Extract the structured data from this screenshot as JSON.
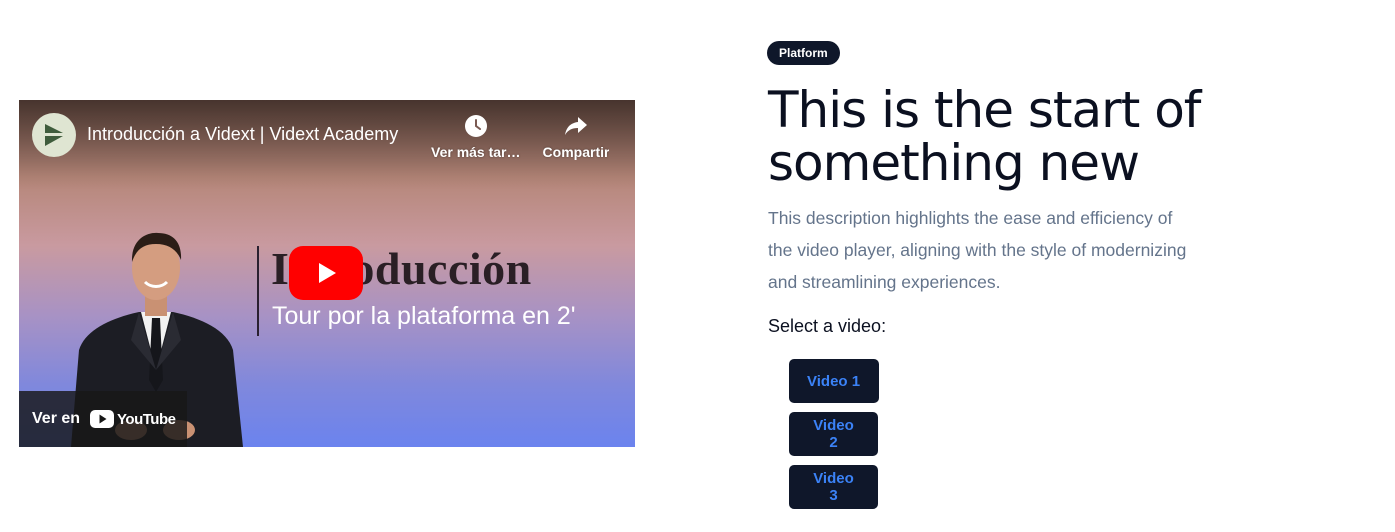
{
  "player": {
    "title": "Introducción a Vidext | Vidext Academy",
    "watch_later_label": "Ver más tarde",
    "share_label": "Compartir",
    "slide_heading": "Introducción",
    "slide_subtitle": "Tour por la plataforma en 2'",
    "watch_on_label": "Ver en",
    "youtube_word": "YouTube",
    "icons": {
      "channel": "channel-logo-icon",
      "watch_later": "clock-icon",
      "share": "share-arrow-icon",
      "play": "play-icon",
      "youtube": "youtube-logo-icon"
    },
    "colors": {
      "play_button": "#ff0000"
    }
  },
  "content": {
    "badge": "Platform",
    "headline": "This is the start of something new",
    "description": "This description highlights the ease and efficiency of the video player, aligning with the style of modernizing and streamlining experiences.",
    "select_label": "Select a video:",
    "buttons": [
      {
        "label": "Video 1"
      },
      {
        "label": "Video 2"
      },
      {
        "label": "Video 3"
      }
    ],
    "colors": {
      "button_bg": "#0f172a",
      "button_text": "#3b82f6",
      "badge_bg": "#0f172a"
    }
  }
}
